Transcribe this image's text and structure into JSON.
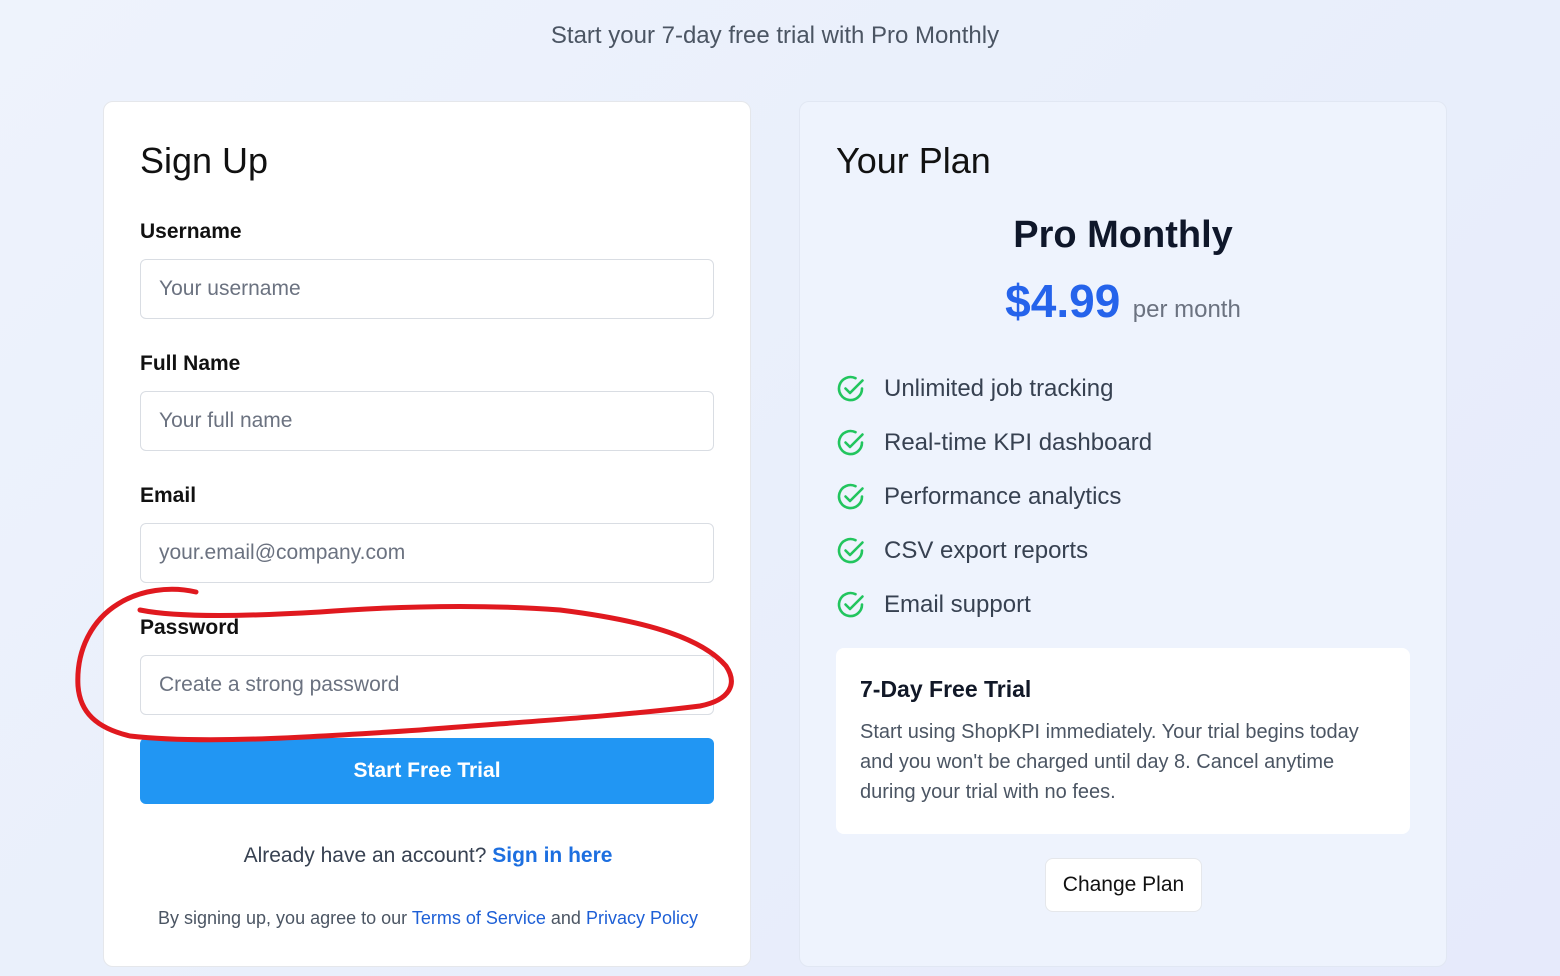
{
  "header": {
    "subtitle": "Start your 7-day free trial with Pro Monthly"
  },
  "signup": {
    "title": "Sign Up",
    "fields": [
      {
        "label": "Username",
        "placeholder": "Your username",
        "value": ""
      },
      {
        "label": "Full Name",
        "placeholder": "Your full name",
        "value": ""
      },
      {
        "label": "Email",
        "placeholder": "your.email@company.com",
        "value": ""
      },
      {
        "label": "Password",
        "placeholder": "Create a strong password",
        "value": ""
      }
    ],
    "submit_label": "Start Free Trial",
    "signin_prompt": "Already have an account?",
    "signin_link": "Sign in here",
    "terms_prefix": "By signing up, you agree to our",
    "terms_link": "Terms of Service",
    "terms_and": "and",
    "privacy_link": "Privacy Policy"
  },
  "plan": {
    "title": "Your Plan",
    "name": "Pro Monthly",
    "price": "$4.99",
    "period": "per month",
    "features": [
      "Unlimited job tracking",
      "Real-time KPI dashboard",
      "Performance analytics",
      "CSV export reports",
      "Email support"
    ],
    "feature_icon": "check-circle-icon",
    "trial": {
      "title": "7-Day Free Trial",
      "description": "Start using ShopKPI immediately. Your trial begins today and you won't be charged until day 8. Cancel anytime during your trial with no fees."
    },
    "change_label": "Change Plan"
  },
  "colors": {
    "accent": "#2196f3",
    "price": "#2563eb",
    "link": "#1d6fe0",
    "check": "#22c55e",
    "annotation": "#e0191f"
  }
}
